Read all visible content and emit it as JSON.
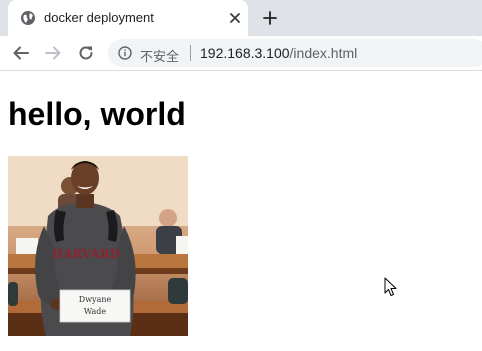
{
  "browser": {
    "tab": {
      "title": "docker deployment",
      "icon": "globe-icon",
      "close_icon": "close-icon"
    },
    "new_tab_icon": "plus-icon",
    "toolbar": {
      "back_icon": "arrow-left-icon",
      "forward_icon": "arrow-right-icon",
      "reload_icon": "reload-icon"
    },
    "address_bar": {
      "security_icon": "info-icon",
      "security_label": "不安全",
      "url_host": "192.168.3.100",
      "url_path": "/index.html"
    }
  },
  "page": {
    "heading": "hello, world",
    "image": {
      "sign_line1": "Dwyane",
      "sign_line2": "Wade",
      "shirt_text": "HARVARD"
    }
  },
  "colors": {
    "tabstrip_bg": "#dee1e6",
    "omnibox_bg": "#f1f3f4",
    "text_primary": "#202124",
    "text_secondary": "#5f6368"
  }
}
